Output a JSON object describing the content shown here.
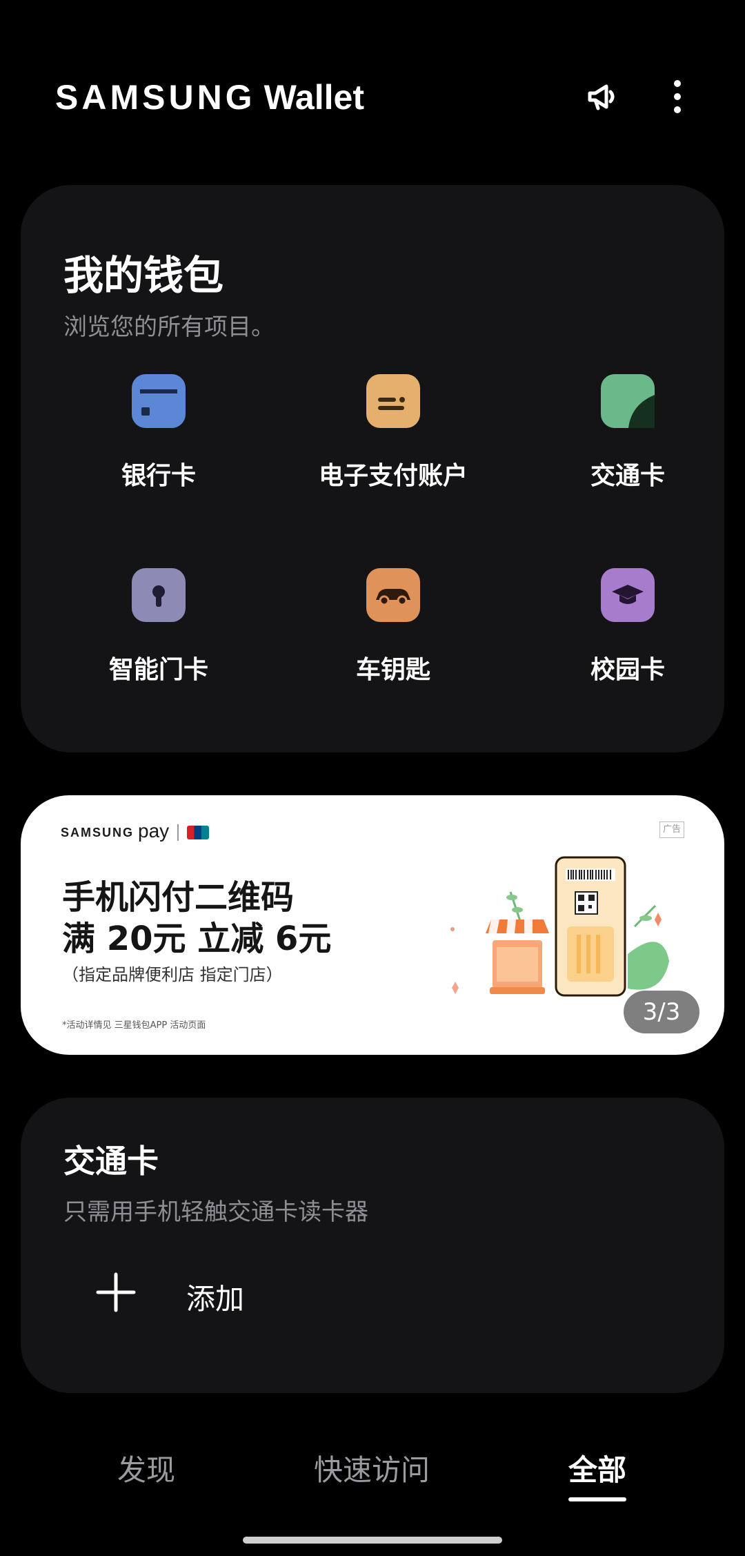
{
  "header": {
    "brand_samsung": "SAMSUNG",
    "brand_wallet": "Wallet",
    "icons": [
      "megaphone-icon",
      "more-vertical-icon"
    ]
  },
  "wallet": {
    "title": "我的钱包",
    "subtitle": "浏览您的所有项目。",
    "categories": [
      {
        "label": "银行卡",
        "icon": "bank-card-icon",
        "color": "#5B87D6"
      },
      {
        "label": "电子支付账户",
        "icon": "e-payment-icon",
        "color": "#E5B06E"
      },
      {
        "label": "交通卡",
        "icon": "transit-card-icon",
        "color": "#6BB88A"
      },
      {
        "label": "智能门卡",
        "icon": "smart-key-icon",
        "color": "#8D8AB5"
      },
      {
        "label": "车钥匙",
        "icon": "car-key-icon",
        "color": "#E0925B"
      },
      {
        "label": "校园卡",
        "icon": "campus-card-icon",
        "color": "#A77CCC"
      }
    ]
  },
  "banner": {
    "brand_samsung": "SAMSUNG",
    "brand_pay": "pay",
    "ad_tag": "广告",
    "headline_1": "手机闪付二维码",
    "headline_2": "满 20元 立减 6元",
    "note": "（指定品牌便利店 指定门店）",
    "fine_print": "*活动详情见 三星钱包APP 活动页面",
    "pager": "3/3"
  },
  "transit": {
    "title": "交通卡",
    "subtitle": "只需用手机轻触交通卡读卡器",
    "add_label": "添加"
  },
  "bottom_nav": {
    "tabs": [
      "发现",
      "快速访问",
      "全部"
    ],
    "active": "全部"
  }
}
